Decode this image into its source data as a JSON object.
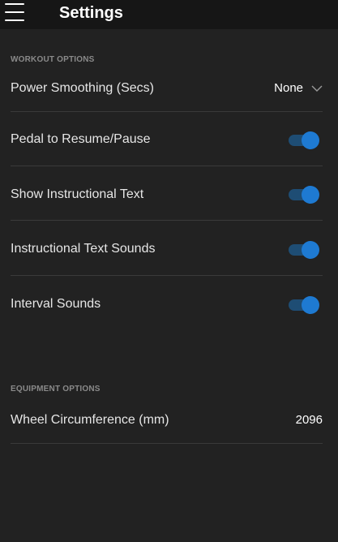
{
  "header": {
    "title": "Settings",
    "menu_icon": "hamburger-menu-icon"
  },
  "workout": {
    "section_label": "WORKOUT OPTIONS",
    "power_smoothing": {
      "label": "Power Smoothing (Secs)",
      "value": "None"
    },
    "pedal_resume": {
      "label": "Pedal to Resume/Pause",
      "on": true
    },
    "instructional_text": {
      "label": "Show Instructional Text",
      "on": true
    },
    "instructional_sounds": {
      "label": "Instructional Text Sounds",
      "on": true
    },
    "interval_sounds": {
      "label": "Interval Sounds",
      "on": true
    }
  },
  "equipment": {
    "section_label": "EQUIPMENT OPTIONS",
    "wheel_circumference": {
      "label": "Wheel Circumference (mm)",
      "value": "2096"
    }
  },
  "colors": {
    "background": "#222222",
    "header": "#161616",
    "toggle_track": "#1e4d74",
    "toggle_thumb": "#1e7ad2",
    "divider": "#3a3a3a",
    "section_label": "#8a8a8a"
  }
}
